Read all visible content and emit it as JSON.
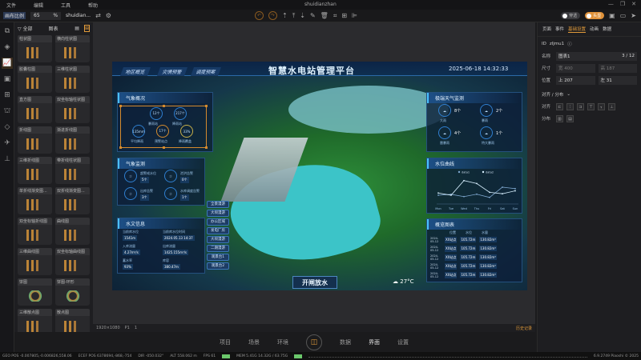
{
  "menu": [
    "文件",
    "编辑",
    "工具",
    "帮助"
  ],
  "window_title": "shuidianzhan",
  "toolbar": {
    "scale_label": "画布比例",
    "scale_value": "65",
    "scale_unit": "%",
    "project": "shuidian...",
    "toggle1": "穿透",
    "toggle2": "头显"
  },
  "left_panel": {
    "filter": "全部",
    "tab": "图表",
    "items": [
      "柱状图",
      "横向柱状图",
      "胶囊柱图",
      "三维柱状图",
      "直方图",
      "双坐标轴柱状图",
      "折线图",
      "渐进折线图",
      "三维折线图",
      "带折线柱状图",
      "单折线渐变图...",
      "双折线渐变图...",
      "双坐标轴折线图",
      "曲线图",
      "三维曲线图",
      "双坐标轴曲线图",
      "饼图",
      "饼图-环形",
      "三维散点图",
      "散点图"
    ]
  },
  "dashboard": {
    "title": "智慧水电站管理平台",
    "datetime": "2025-06-18 14:32:33",
    "nav_tabs": [
      "地区概览",
      "灾情预警",
      "调度预案"
    ],
    "weather_overview": {
      "title": "气象概况",
      "items": [
        {
          "v": "12个",
          "l": "暴雨站"
        },
        {
          "v": "217个",
          "l": "降雨站"
        },
        {
          "v": "135mm",
          "l": "平均降雨"
        },
        {
          "v": "17个",
          "l": "预警站点"
        },
        {
          "v": "33%",
          "l": "降雨覆盖"
        }
      ]
    },
    "weather_monitor": {
      "title": "气象监测",
      "items": [
        {
          "l": "超警戒水位",
          "v": "5个"
        },
        {
          "l": "泄洪告警",
          "v": "0个"
        },
        {
          "l": "出库告警",
          "v": "3个"
        },
        {
          "l": "水库调度告警",
          "v": "1个"
        }
      ]
    },
    "hydro": {
      "title": "水文信息",
      "items": [
        {
          "l": "当前库水位",
          "v": "1541m"
        },
        {
          "l": "当前库水位时间",
          "v": "2024.05.13 14:37"
        },
        {
          "l": "入库流量",
          "v": "4.27m³/s"
        },
        {
          "l": "出库流量",
          "v": "1425.155m³/s"
        },
        {
          "l": "蓄水率",
          "v": "93%"
        },
        {
          "l": "库容",
          "v": "380.47m"
        }
      ]
    },
    "nav_buttons": [
      "全景漫游",
      "大坝漫游",
      "办公区域",
      "发电厂房",
      "大坝漫游",
      "二期漫游",
      "观景台1",
      "观景台2"
    ],
    "extreme_weather": {
      "title": "极端天气监测",
      "items": [
        {
          "v": "8个",
          "l": "大雨"
        },
        {
          "v": "2个",
          "l": "暴雨"
        },
        {
          "v": "4个",
          "l": "雷暴雨"
        },
        {
          "v": "1个",
          "l": "特大暴雨"
        }
      ]
    },
    "water_curve": {
      "title": "水位曲线",
      "legend": [
        "data1",
        "data2"
      ],
      "x": [
        "Mon",
        "Tue",
        "Wed",
        "Thu",
        "Fri",
        "Sat",
        "Sun"
      ],
      "data1": [
        120,
        132,
        101,
        134,
        90,
        230,
        210
      ],
      "data2": [
        150,
        120,
        320,
        280,
        160,
        140,
        180
      ]
    },
    "overview_table": {
      "title": "概览图表",
      "headers": [
        "位置",
        "水位",
        "水量"
      ],
      "rows": [
        [
          "2024-05-12",
          "XX站点",
          "105.72m",
          "130.82m³"
        ],
        [
          "2024-05-12",
          "XX站点",
          "105.72m",
          "130.82m³"
        ],
        [
          "2024-05-12",
          "XX站点",
          "105.72m",
          "130.82m³"
        ],
        [
          "2024-05-12",
          "XX站点",
          "105.72m",
          "130.82m³"
        ],
        [
          "2024-05-12",
          "XX站点",
          "105.72m",
          "130.82m³"
        ]
      ]
    },
    "action_button": "开闸放水",
    "temperature": "27°C"
  },
  "canvas_bar": {
    "resolution": "1920×1080",
    "page": "P1",
    "count": "1",
    "history": "历史记录"
  },
  "right_panel": {
    "tabs": [
      "页面",
      "事件",
      "基础设置",
      "动画",
      "数据"
    ],
    "active": 2,
    "id": "zljmu1",
    "name_label": "名称",
    "name": "图表1",
    "name_count": "3 / 12",
    "size_label": "尺寸",
    "width": "宽 400",
    "height": "高 187",
    "pos_label": "位置",
    "top": "上 207",
    "left": "左 31",
    "align_section": "对齐 / 分布",
    "align_label": "对齐",
    "dist_label": "分布"
  },
  "bottom_tabs": [
    "项目",
    "场景",
    "环境",
    "数据",
    "界面",
    "设置"
  ],
  "status": {
    "geo": "GEO POS -0.007805,-0.006826,558.06",
    "ecef": "ECEF POS 6378694,-868,-754",
    "dir": "DIR -050.032°",
    "alt": "ALT 558.062 m",
    "fps": "FPS 61",
    "mem": "MEM 5.41G 14.32G / 63.75G",
    "version": "6.9.2749 Piaoshi © 2025"
  },
  "accent": "#e09a3a"
}
